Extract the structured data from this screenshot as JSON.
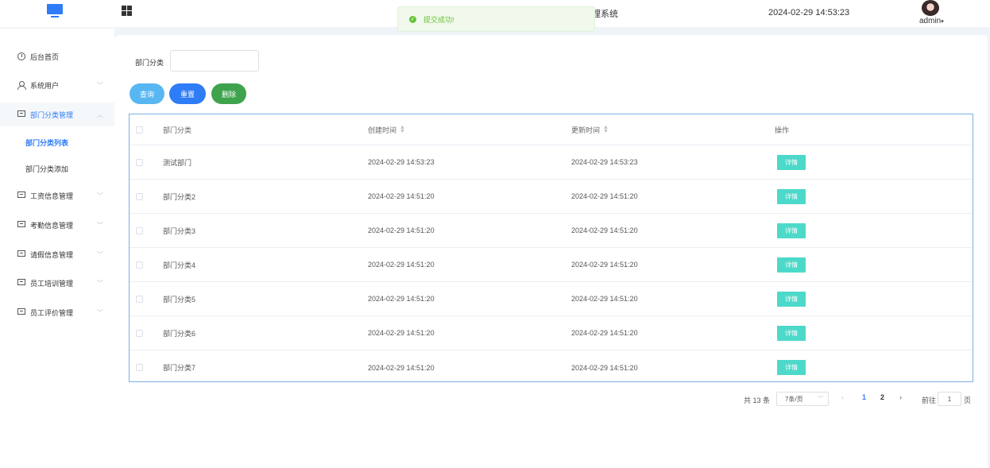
{
  "header": {
    "title_fragment": "理系统",
    "datetime": "2024-02-29 14:53:23",
    "username": "admin",
    "dropdown_caret": "▾"
  },
  "toast": {
    "message": "提交成功!",
    "type": "success"
  },
  "sidebar": {
    "items": [
      {
        "label": "后台首页",
        "icon": "clock-icon"
      },
      {
        "label": "系统用户",
        "icon": "user-icon"
      },
      {
        "label": "部门分类管理",
        "icon": "box-icon",
        "expanded": true
      },
      {
        "label": "工资信息管理",
        "icon": "box-icon"
      },
      {
        "label": "考勤信息管理",
        "icon": "box-icon"
      },
      {
        "label": "请假信息管理",
        "icon": "box-icon"
      },
      {
        "label": "员工培训管理",
        "icon": "box-icon"
      },
      {
        "label": "员工评价管理",
        "icon": "box-icon"
      }
    ],
    "sub_items": [
      {
        "label": "部门分类列表",
        "active": true
      },
      {
        "label": "部门分类添加",
        "active": false
      }
    ],
    "chevron_down": "﹀",
    "chevron_up": "︿"
  },
  "filter": {
    "label": "部门分类",
    "value": ""
  },
  "buttons": {
    "query": "查询",
    "reset": "重置",
    "delete": "删除"
  },
  "table": {
    "headers": {
      "name": "部门分类",
      "created": "创建时间",
      "updated": "更新时间",
      "actions": "操作"
    },
    "rows": [
      {
        "name": "测试部门",
        "created": "2024-02-29 14:53:23",
        "updated": "2024-02-29 14:53:23",
        "action": "详情"
      },
      {
        "name": "部门分类2",
        "created": "2024-02-29 14:51:20",
        "updated": "2024-02-29 14:51:20",
        "action": "详情"
      },
      {
        "name": "部门分类3",
        "created": "2024-02-29 14:51:20",
        "updated": "2024-02-29 14:51:20",
        "action": "详情"
      },
      {
        "name": "部门分类4",
        "created": "2024-02-29 14:51:20",
        "updated": "2024-02-29 14:51:20",
        "action": "详情"
      },
      {
        "name": "部门分类5",
        "created": "2024-02-29 14:51:20",
        "updated": "2024-02-29 14:51:20",
        "action": "详情"
      },
      {
        "name": "部门分类6",
        "created": "2024-02-29 14:51:20",
        "updated": "2024-02-29 14:51:20",
        "action": "详情"
      },
      {
        "name": "部门分类7",
        "created": "2024-02-29 14:51:20",
        "updated": "2024-02-29 14:51:20",
        "action": "详情"
      }
    ]
  },
  "pagination": {
    "total": "共 13 条",
    "page_size": "7条/页",
    "prev": "‹",
    "next": "›",
    "pages": [
      "1",
      "2"
    ],
    "current_page": "1",
    "goto_label": "前往",
    "goto_value": "1",
    "goto_suffix": "页"
  },
  "colors": {
    "primary": "#2e7cf6",
    "success": "#67c23a",
    "query_button": "#58b7f2",
    "delete_button": "#3fa34d",
    "detail_button": "#4dd9c9"
  }
}
